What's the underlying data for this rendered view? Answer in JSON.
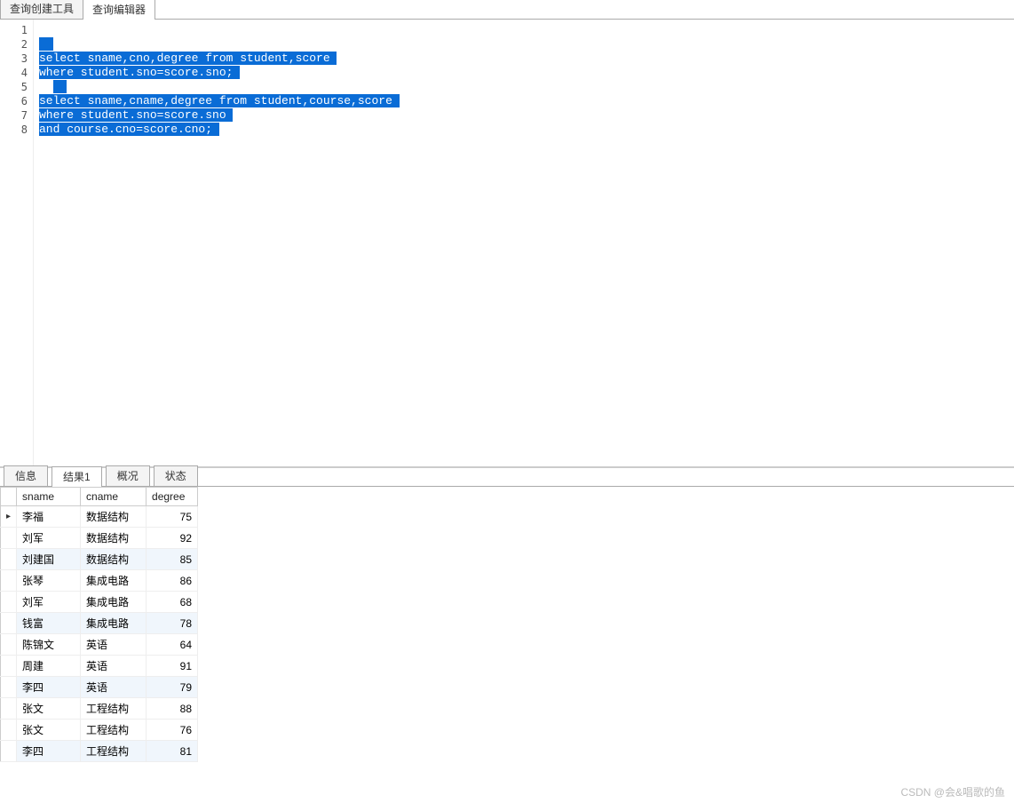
{
  "topTabs": [
    {
      "label": "查询创建工具",
      "active": false
    },
    {
      "label": "查询编辑器",
      "active": true
    }
  ],
  "editor": {
    "lines": [
      {
        "n": 1,
        "text": "",
        "selected": false
      },
      {
        "n": 2,
        "text": "",
        "selected": true
      },
      {
        "n": 3,
        "text": "select sname,cno,degree from student,score",
        "selected": true
      },
      {
        "n": 4,
        "text": "where student.sno=score.sno;",
        "selected": true
      },
      {
        "n": 5,
        "text": "",
        "selected": true,
        "indent": true
      },
      {
        "n": 6,
        "text": "select sname,cname,degree from student,course,score",
        "selected": true
      },
      {
        "n": 7,
        "text": "where student.sno=score.sno",
        "selected": true
      },
      {
        "n": 8,
        "text": "and course.cno=score.cno;",
        "selected": true
      }
    ]
  },
  "bottomTabs": [
    {
      "label": "信息",
      "active": false
    },
    {
      "label": "结果1",
      "active": true
    },
    {
      "label": "概况",
      "active": false
    },
    {
      "label": "状态",
      "active": false
    }
  ],
  "results": {
    "columns": [
      "sname",
      "cname",
      "degree"
    ],
    "rows": [
      {
        "sname": "李福",
        "cname": "数据结构",
        "degree": 75,
        "current": true
      },
      {
        "sname": "刘军",
        "cname": "数据结构",
        "degree": 92
      },
      {
        "sname": "刘建国",
        "cname": "数据结构",
        "degree": 85
      },
      {
        "sname": "张琴",
        "cname": "集成电路",
        "degree": 86
      },
      {
        "sname": "刘军",
        "cname": "集成电路",
        "degree": 68
      },
      {
        "sname": "钱富",
        "cname": "集成电路",
        "degree": 78
      },
      {
        "sname": "陈锦文",
        "cname": "英语",
        "degree": 64
      },
      {
        "sname": "周建",
        "cname": "英语",
        "degree": 91
      },
      {
        "sname": "李四",
        "cname": "英语",
        "degree": 79
      },
      {
        "sname": "张文",
        "cname": "工程结构",
        "degree": 88
      },
      {
        "sname": "张文",
        "cname": "工程结构",
        "degree": 76
      },
      {
        "sname": "李四",
        "cname": "工程结构",
        "degree": 81
      }
    ]
  },
  "footerWatermark": "CSDN @会&唱歌的鱼"
}
